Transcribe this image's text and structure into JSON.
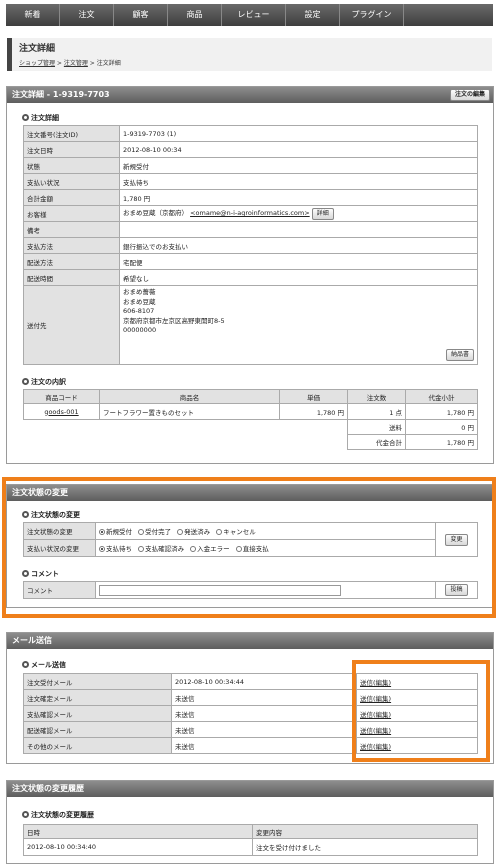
{
  "nav": [
    "新着",
    "注文",
    "顧客",
    "商品",
    "レビュー",
    "設定",
    "プラグイン"
  ],
  "page": {
    "title": "注文詳細",
    "breadcrumb": [
      "ショップ管理",
      "注文管理",
      "注文詳細"
    ],
    "breadcrumb_sep": " > "
  },
  "order_panel": {
    "title": "注文詳細 - 1-9319-7703",
    "edit_button": "注文の編集",
    "section_title": "注文詳細",
    "rows": [
      {
        "label": "注文番号(注文ID)",
        "value": "1-9319-7703 (1)"
      },
      {
        "label": "注文日時",
        "value": "2012-08-10 00:34"
      },
      {
        "label": "状態",
        "value": "新規受付"
      },
      {
        "label": "支払い状況",
        "value": "支払待ち"
      },
      {
        "label": "合計金額",
        "value": "1,780 円"
      }
    ],
    "customer": {
      "label": "お客様",
      "name": "おまめ豆蔵（京都府）",
      "email": "<omame@n-i-agroinformatics.com>",
      "detail_button": "詳細"
    },
    "rows2": [
      {
        "label": "備考",
        "value": ""
      },
      {
        "label": "支払方法",
        "value": "銀行振込でのお支払い"
      },
      {
        "label": "配送方法",
        "value": "宅配便"
      },
      {
        "label": "配送時間",
        "value": "希望なし"
      }
    ],
    "shipping": {
      "label": "送付先",
      "lines": [
        "おまめ薔薇",
        "おまめ豆蔵",
        "606-8107",
        "京都府京都市左京区高野東開町8-5",
        "00000000"
      ],
      "delivery_slip_button": "納品書"
    }
  },
  "order_items": {
    "section_title": "注文の内訳",
    "headers": [
      "商品コード",
      "商品名",
      "単価",
      "注文数",
      "代金小計"
    ],
    "items": [
      {
        "code": "goods-001",
        "name": "フートフラワー置きものセット",
        "price": "1,780 円",
        "qty": "1 点",
        "subtotal": "1,780 円"
      }
    ],
    "shipping_label": "送料",
    "shipping_value": "0 円",
    "total_label": "代金合計",
    "total_value": "1,780 円"
  },
  "status_panel": {
    "title": "注文状態の変更",
    "section_title": "注文状態の変更",
    "order_status_label": "注文状態の変更",
    "order_status_options": [
      {
        "label": "新規受付",
        "selected": true
      },
      {
        "label": "受付完了",
        "selected": false
      },
      {
        "label": "発送済み",
        "selected": false
      },
      {
        "label": "キャンセル",
        "selected": false
      }
    ],
    "payment_status_label": "支払い状況の変更",
    "payment_status_options": [
      {
        "label": "支払待ち",
        "selected": true
      },
      {
        "label": "支払確認済み",
        "selected": false
      },
      {
        "label": "入金エラー",
        "selected": false
      },
      {
        "label": "直接支払",
        "selected": false
      }
    ],
    "change_button": "変更",
    "comment_section_title": "コメント",
    "comment_label": "コメント",
    "comment_value": "",
    "post_button": "投稿"
  },
  "mail_panel": {
    "title": "メール送信",
    "section_title": "メール送信",
    "rows": [
      {
        "name": "注文受付メール",
        "status": "2012-08-10 00:34:44",
        "action": "送信(編集)"
      },
      {
        "name": "注文確定メール",
        "status": "未送信",
        "action": "送信(編集)"
      },
      {
        "name": "支払確認メール",
        "status": "未送信",
        "action": "送信(編集)"
      },
      {
        "name": "配送確認メール",
        "status": "未送信",
        "action": "送信(編集)"
      },
      {
        "name": "その他のメール",
        "status": "未送信",
        "action": "送信(編集)"
      }
    ]
  },
  "history_panel": {
    "title": "注文状態の変更履歴",
    "section_title": "注文状態の変更履歴",
    "headers": [
      "日時",
      "変更内容"
    ],
    "rows": [
      {
        "date": "2012-08-10 00:34:40",
        "content": "注文を受け付けました"
      }
    ]
  },
  "colors": {
    "highlight": "#ef7f1a",
    "nav": "#4e4e4e",
    "label_bg": "#e2e2e2"
  }
}
